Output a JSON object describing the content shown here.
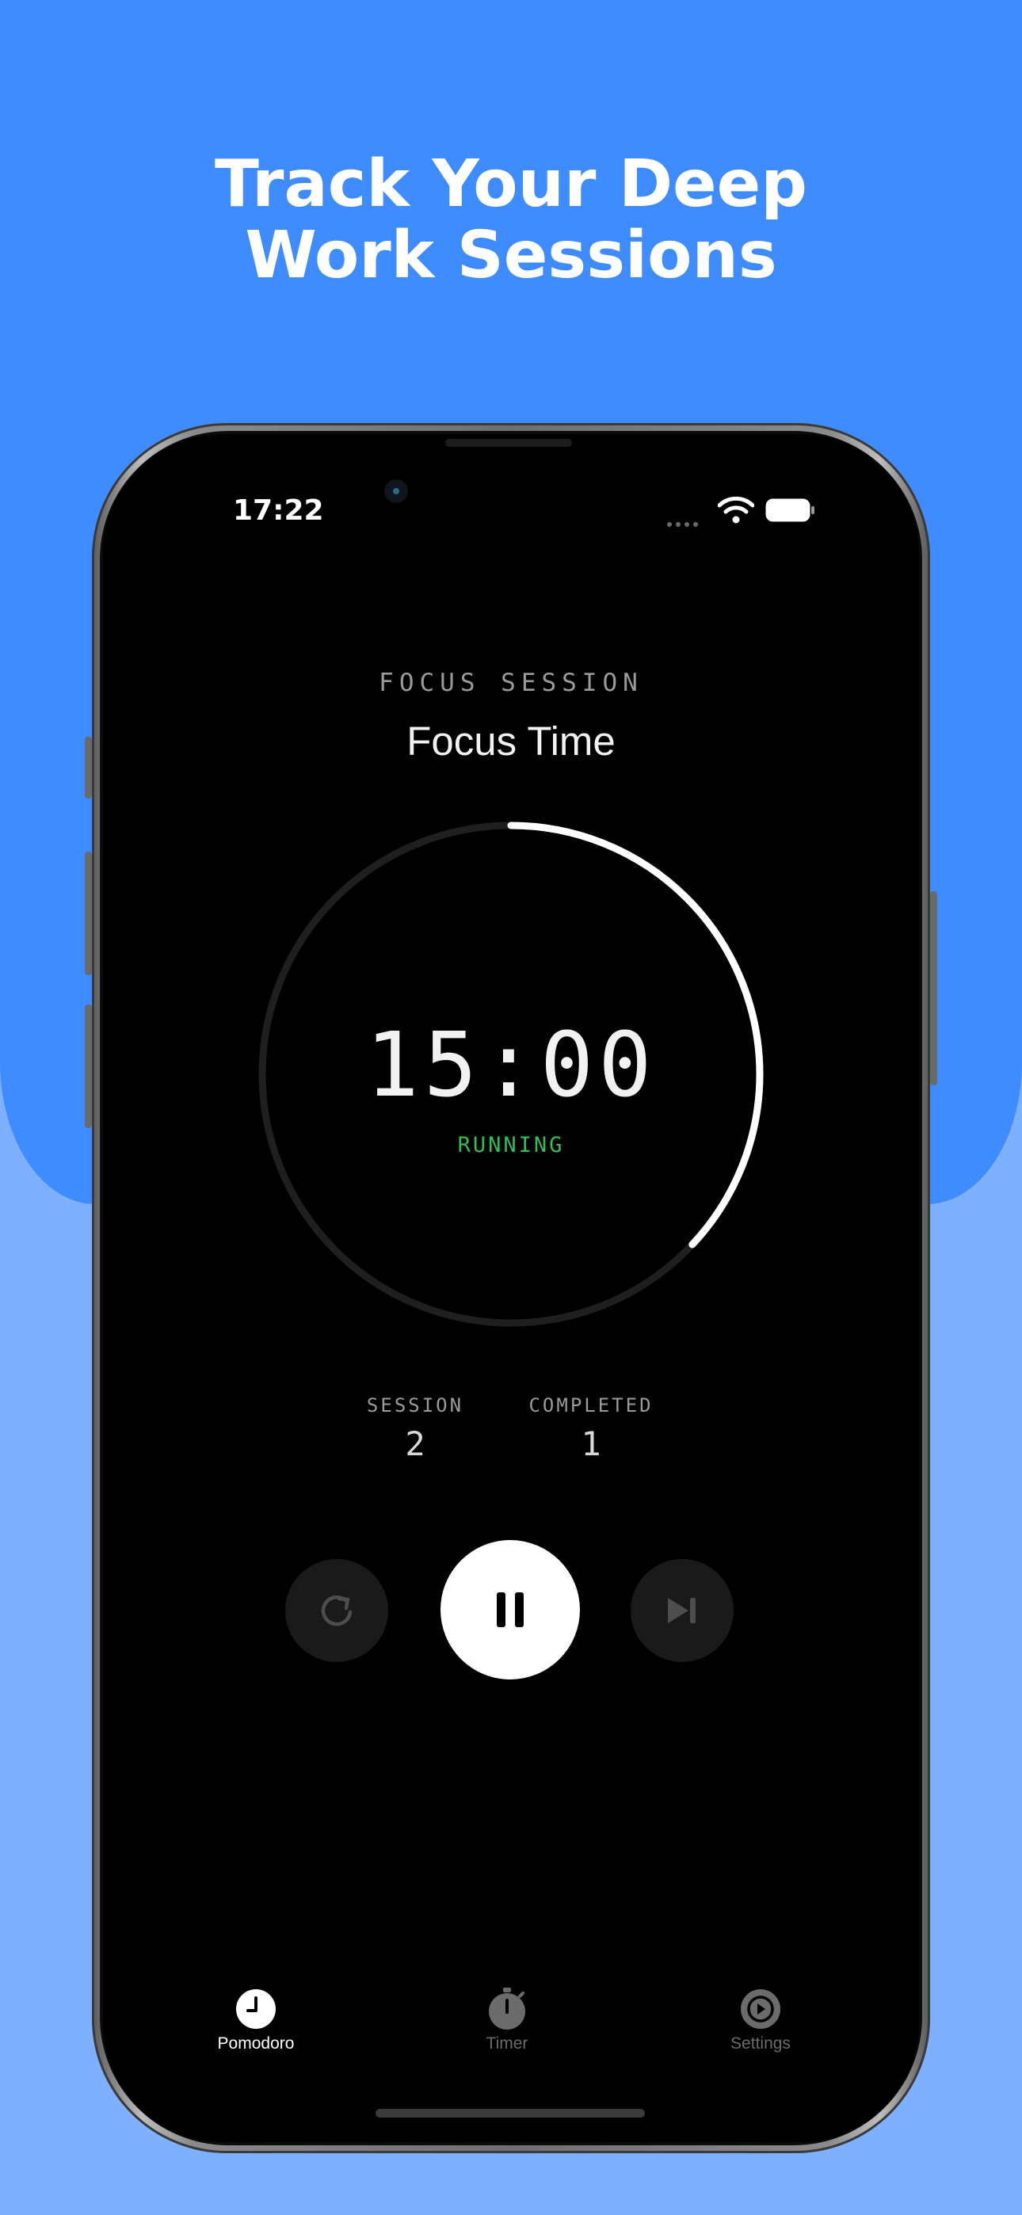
{
  "promo": {
    "headline_line1": "Track Your Deep",
    "headline_line2": "Work Sessions"
  },
  "status_bar": {
    "time": "17:22",
    "icons": [
      "cellular-dots-icon",
      "wifi-icon",
      "battery-icon"
    ]
  },
  "session": {
    "label": "FOCUS SESSION",
    "title": "Focus Time",
    "timer": "15:00",
    "state": "RUNNING",
    "progress_fraction": 0.37
  },
  "stats": {
    "session_label": "SESSION",
    "session_value": "2",
    "completed_label": "COMPLETED",
    "completed_value": "1"
  },
  "controls": {
    "reset_icon": "reset-icon",
    "pause_icon": "pause-icon",
    "skip_icon": "skip-forward-icon"
  },
  "tabs": [
    {
      "label": "Pomodoro",
      "icon": "clock-icon",
      "active": true
    },
    {
      "label": "Timer",
      "icon": "stopwatch-icon",
      "active": false
    },
    {
      "label": "Settings",
      "icon": "gear-icon",
      "active": false
    }
  ],
  "colors": {
    "background_top": "#3e8cff",
    "background_bottom": "#7fb0ff",
    "running_green": "#2fbf57",
    "ring_progress": "#ffffff",
    "ring_track": "#1f1f1f"
  }
}
